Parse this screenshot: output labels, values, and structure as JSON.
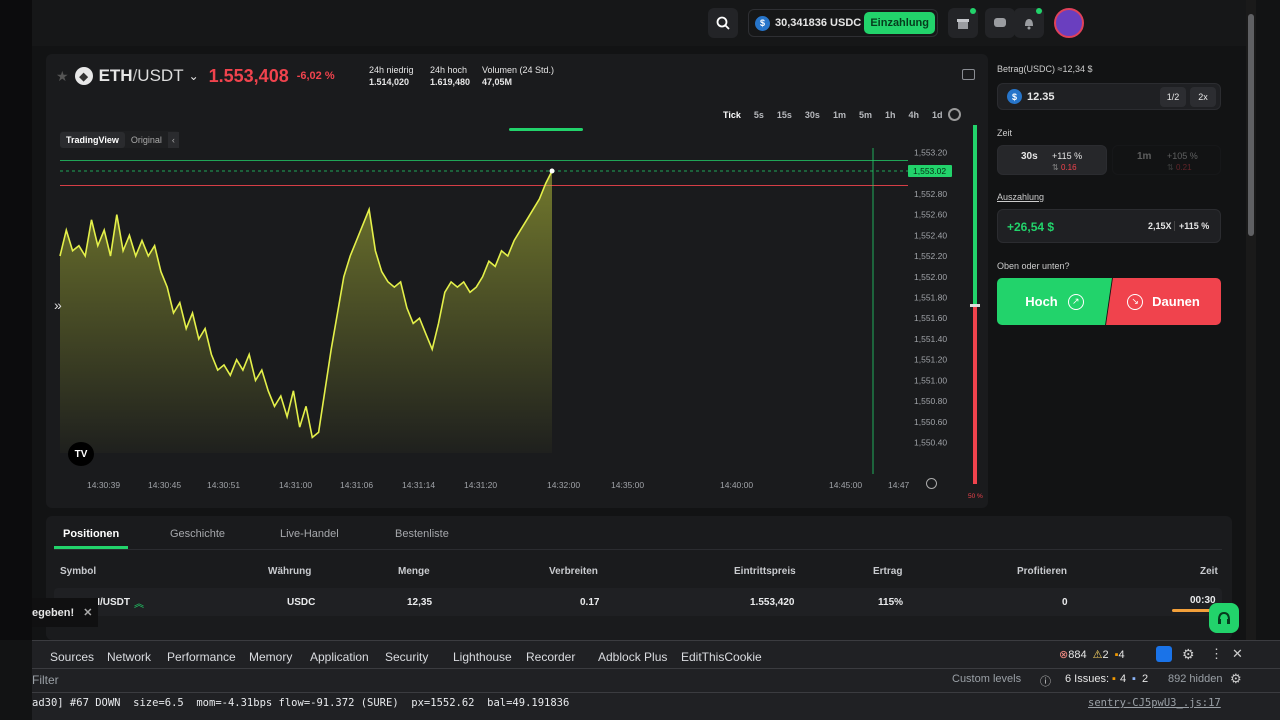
{
  "topbar": {
    "balance": "30,341836 USDC",
    "coin_symbol": "$",
    "deposit_label": "Einzahlung"
  },
  "ticker": {
    "pair_base": "ETH",
    "pair_sep": "/",
    "pair_quote": "USDT",
    "price": "1.553,408",
    "change": "-6,02 %",
    "low_label": "24h niedrig",
    "low_value": "1.514,020",
    "high_label": "24h hoch",
    "high_value": "1.619,480",
    "volume_label": "Volumen (24 Std.)",
    "volume_value": "47,05M"
  },
  "timeframes": [
    "Tick",
    "5s",
    "15s",
    "30s",
    "1m",
    "5m",
    "1h",
    "4h",
    "1d"
  ],
  "chart_toggle": {
    "tradingview": "TradingView",
    "original": "Original"
  },
  "chart_data": {
    "type": "line",
    "y_ticks": [
      "1,553.20",
      "1,552.80",
      "1,552.60",
      "1,552.40",
      "1,552.20",
      "1,552.00",
      "1,551.80",
      "1,551.60",
      "1,551.40",
      "1,551.20",
      "1,551.00",
      "1,550.80",
      "1,550.60",
      "1,550.40"
    ],
    "current_price_tag": "1,553.02",
    "x_ticks": [
      "14:30:39",
      "14:30:45",
      "14:30:51",
      "14:31:00",
      "14:31:06",
      "14:31:14",
      "14:31:20",
      "14:32:00",
      "14:35:00",
      "14:40:00",
      "14:45:00",
      "14:47"
    ],
    "ylim": [
      1550.3,
      1553.3
    ],
    "values": [
      1552.2,
      1552.45,
      1552.25,
      1552.3,
      1552.2,
      1552.55,
      1552.3,
      1552.45,
      1552.2,
      1552.6,
      1552.25,
      1552.4,
      1552.2,
      1552.35,
      1552.2,
      1552.3,
      1552.05,
      1551.9,
      1551.65,
      1551.75,
      1551.5,
      1551.65,
      1551.4,
      1551.5,
      1551.25,
      1551.1,
      1551.15,
      1551.05,
      1551.2,
      1551.1,
      1551.25,
      1551.0,
      1551.1,
      1550.9,
      1550.75,
      1550.85,
      1550.65,
      1550.9,
      1550.55,
      1550.75,
      1550.45,
      1550.5,
      1550.9,
      1551.3,
      1551.65,
      1552.0,
      1552.2,
      1552.35,
      1552.5,
      1552.65,
      1552.25,
      1552.05,
      1551.95,
      1551.9,
      1551.95,
      1551.7,
      1551.55,
      1551.6,
      1551.45,
      1551.3,
      1551.55,
      1551.85,
      1551.95,
      1551.9,
      1551.95,
      1551.85,
      1551.9,
      1552.0,
      1552.15,
      1552.1,
      1552.25,
      1552.2,
      1552.35,
      1552.45,
      1552.55,
      1552.65,
      1552.75,
      1552.9,
      1553.02
    ],
    "green_line": 1553.12,
    "red_line": 1552.88,
    "current": 1553.02,
    "pct_top": "50 %",
    "pct_bottom": "50 %"
  },
  "trade": {
    "amount_label": "Betrag(USDC) ≈12,34 $",
    "amount_value": "12.35",
    "half": "1/2",
    "double": "2x",
    "time_label": "Zeit",
    "time1": "30s",
    "time1_pct": "+115 %",
    "time1_spread": "0.16",
    "time2": "1m",
    "time2_pct": "+105 %",
    "time2_spread": "0.21",
    "payout_label": "Auszahlung",
    "payout_value": "+26,54 $",
    "payout_mult": "2,15X",
    "payout_pct": "+115 %",
    "question": "Oben oder unten?",
    "up": "Hoch",
    "down": "Daunen"
  },
  "positions": {
    "tabs": [
      "Positionen",
      "Geschichte",
      "Live-Handel",
      "Bestenliste"
    ],
    "columns": [
      "Symbol",
      "Währung",
      "Menge",
      "Verbreiten",
      "Eintrittspreis",
      "Ertrag",
      "Profitieren",
      "Zeit"
    ],
    "row": [
      "ETH/USDT",
      "USDC",
      "12,35",
      "0.17",
      "1.553,420",
      "115%",
      "0",
      "00:30"
    ],
    "toast": "egeben!"
  },
  "devtools": {
    "tabs": [
      "Sources",
      "Network",
      "Performance",
      "Memory",
      "Application",
      "Security",
      "Lighthouse",
      "Recorder",
      "Adblock Plus",
      "EditThisCookie"
    ],
    "errors": "884",
    "warnings": "2",
    "infos": "4",
    "filter_placeholder": "Filter",
    "levels": "Custom levels",
    "issues_label": "6 Issues:",
    "issues_a": "4",
    "issues_b": "2",
    "hidden": "892 hidden",
    "log_line": "ad30] #67 DOWN  size=6.5  mom=-4.31bps flow=-91.372 (SURE)  px=1552.62  bal=49.191836",
    "log_source": "sentry-CJ5pwU3_.js:17"
  }
}
